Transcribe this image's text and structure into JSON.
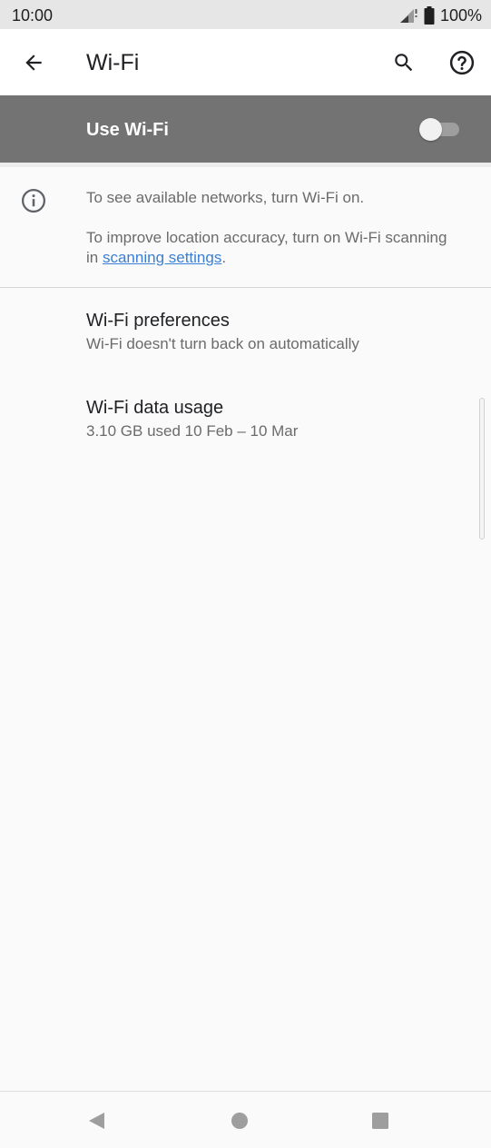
{
  "status_bar": {
    "time": "10:00",
    "battery_percent": "100%"
  },
  "app_bar": {
    "title": "Wi-Fi",
    "icons": [
      "back-arrow-icon",
      "search-icon",
      "help-icon"
    ]
  },
  "master_switch": {
    "label": "Use Wi-Fi",
    "state": "off"
  },
  "info": {
    "line1": "To see available networks, turn Wi-Fi on.",
    "line2_prefix": "To improve location accuracy, turn on Wi-Fi scanning in ",
    "line2_link": "scanning settings",
    "line2_suffix": "."
  },
  "list": [
    {
      "title": "Wi-Fi preferences",
      "summary": "Wi-Fi doesn't turn back on automatically"
    },
    {
      "title": "Wi-Fi data usage",
      "summary": "3.10 GB used 10 Feb – 10 Mar"
    }
  ],
  "colors": {
    "status_bar_bg": "#e6e6e6",
    "switch_bar_bg": "#737373",
    "link": "#3b7fd4",
    "icon": "#202124"
  }
}
